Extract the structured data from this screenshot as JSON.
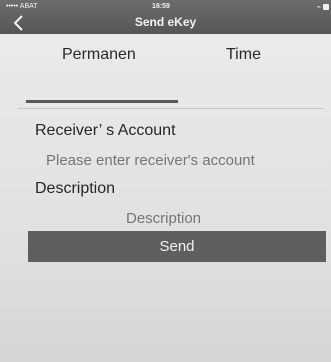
{
  "status_bar": {
    "carrier": "••••• ABAT",
    "time": "16:59",
    "signal_icon": "wifi-icon",
    "battery_icon": "battery-icon"
  },
  "header": {
    "title": "Send eKey",
    "back_icon": "chevron-left-icon"
  },
  "tabs": [
    {
      "label": "Permanen",
      "selected": true
    },
    {
      "label": "Time",
      "selected": false
    }
  ],
  "form": {
    "receiver_label": "Receiver’ s Account",
    "receiver_placeholder": "Please enter receiver's account",
    "description_label": "Description",
    "description_placeholder": "Description"
  },
  "actions": {
    "send_label": "Send"
  },
  "colors": {
    "topbar": "#5f5f5f",
    "button": "#5f5f5f",
    "background": "#e6e6e6"
  }
}
